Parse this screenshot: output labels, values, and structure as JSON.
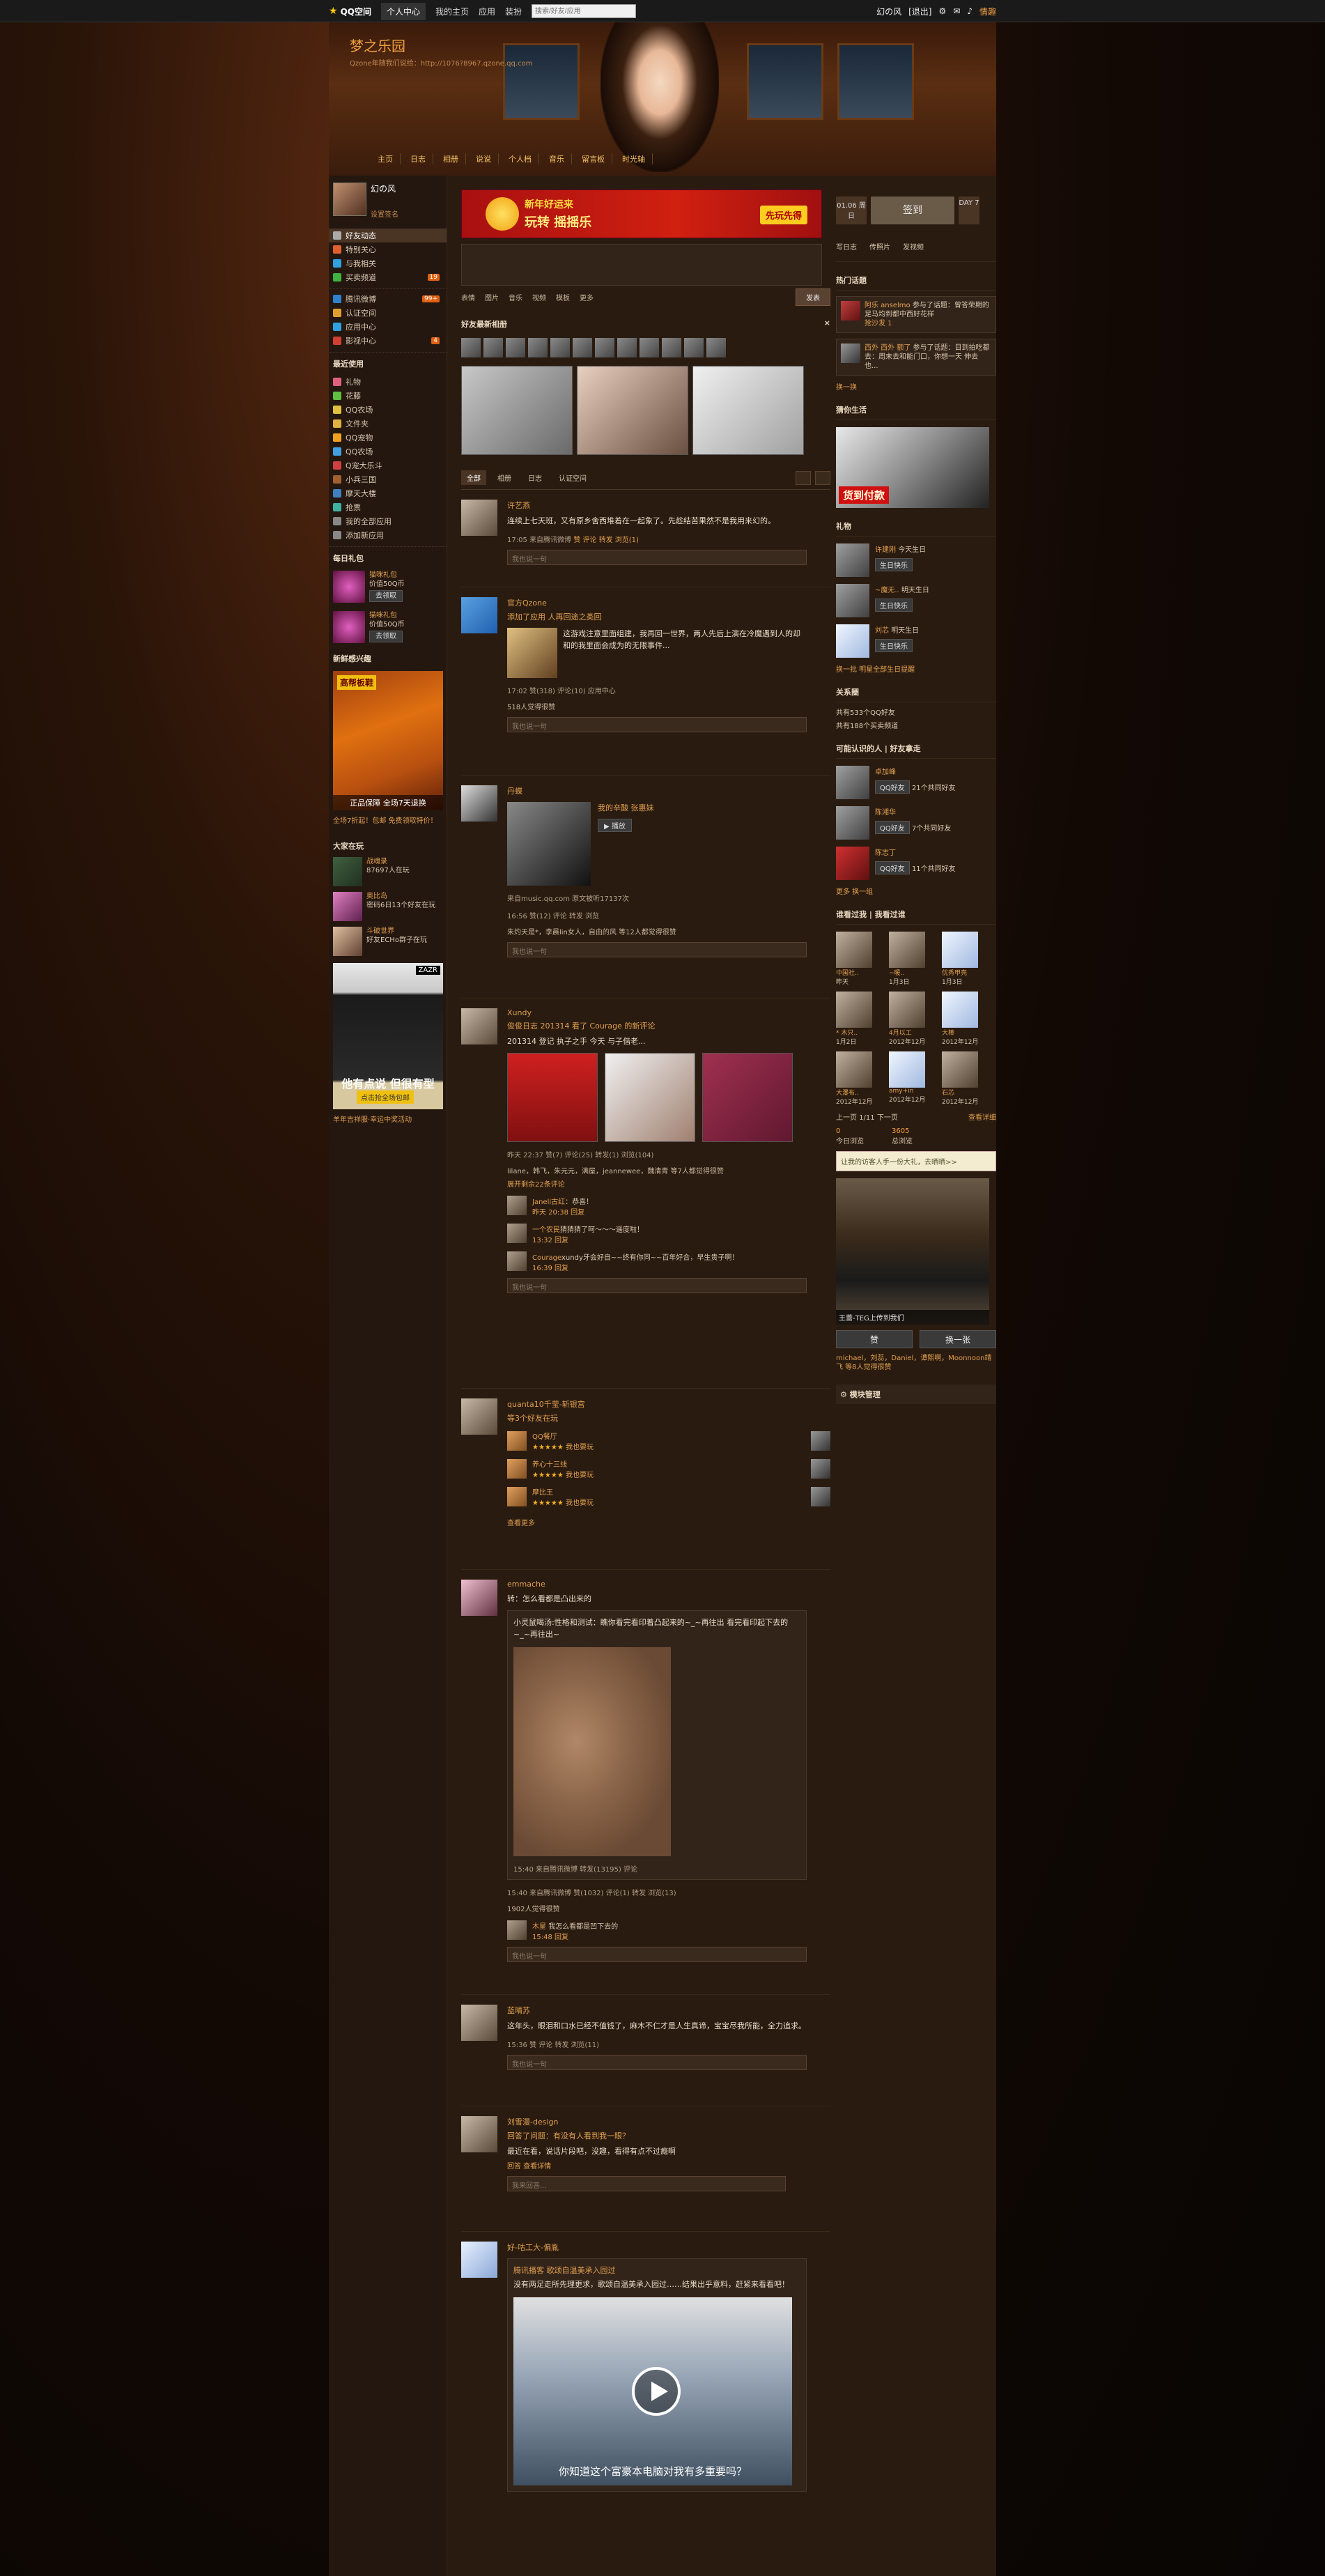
{
  "topbar": {
    "logo": "QQ空间",
    "tabs": [
      "个人中心",
      "我的主页",
      "应用",
      "装扮"
    ],
    "search_placeholder": "搜索/好友/应用",
    "user": "幻の风",
    "exit": "[退出]",
    "right": [
      "情趣"
    ]
  },
  "header": {
    "title": "梦之乐园",
    "url": "Qzone年随我们说给：http://1076?8967.qzone.qq.com",
    "nav": [
      "主页",
      "日志",
      "相册",
      "说说",
      "个人档",
      "音乐",
      "留言板",
      "时光轴"
    ]
  },
  "left": {
    "name": "幻の风",
    "sub": "设置签名",
    "menu1": [
      {
        "label": "好友动态",
        "color": "#aaa",
        "badge": ""
      },
      {
        "label": "特别关心",
        "color": "#e06030",
        "badge": ""
      },
      {
        "label": "与我相关",
        "color": "#30a0e0",
        "badge": ""
      },
      {
        "label": "买卖频道",
        "color": "#40b040",
        "badge": "19"
      }
    ],
    "menu2": [
      {
        "label": "腾讯微博",
        "color": "#3080d0",
        "badge": "99+"
      },
      {
        "label": "认证空间",
        "color": "#e0a030",
        "badge": ""
      },
      {
        "label": "应用中心",
        "color": "#30a0e0",
        "badge": ""
      },
      {
        "label": "影视中心",
        "color": "#d04030",
        "badge": "4"
      }
    ],
    "recent_title": "最近使用",
    "recent": [
      "礼物",
      "花藤",
      "QQ农场",
      "文件夹",
      "QQ宠物",
      "QQ农场",
      "Q宠大乐斗",
      "小兵三国",
      "摩天大楼",
      "抢票"
    ],
    "recent_extra": [
      "我的全部应用",
      "添加新应用"
    ],
    "daily_title": "每日礼包",
    "gifts": [
      {
        "name": "猫咪礼包",
        "price": "价值50Q币",
        "btn": "去领取"
      },
      {
        "name": "猫咪礼包",
        "price": "价值50Q币",
        "btn": "去领取"
      }
    ],
    "new_title": "新鲜感兴趣",
    "ad_tag": "高帮板鞋",
    "ad_caption": "正品保障 全场7天退换",
    "ad_link": "全场7折起！包邮 免费领取特价！",
    "online_title": "大家在玩",
    "games": [
      {
        "name": "战魂录",
        "desc": "87697人在玩"
      },
      {
        "name": "奥比岛",
        "desc": "密码6日13个好友在玩"
      },
      {
        "name": "斗破世界",
        "desc": "好友ECHo群子在玩"
      }
    ],
    "jacket_brand": "ZAZR",
    "jacket_text": "他有点说 但很有型",
    "jacket_btn": "点击抢全场包邮",
    "jacket_link": "羊年吉祥服·幸运中奖活动"
  },
  "center": {
    "banner": {
      "t1": "新年好运来",
      "t2": "玩转 摇摇乐",
      "btn": "先玩先得"
    },
    "post_tools": [
      "表情",
      "图片",
      "音乐",
      "视频",
      "模板",
      "更多"
    ],
    "send": "发表",
    "rec_title": "好友最新相册",
    "tabs": [
      "全部",
      "相册",
      "日志",
      "认证空间"
    ],
    "feeds": [
      {
        "name": "许艺燕",
        "body": "连续上七天班，又有原乡舍西堆着在一起象了。先趁结苦果然不是我用来幻的。",
        "meta": "17:05 来自腾讯微博",
        "actions": [
          "赞",
          "评论",
          "转发",
          "浏览(1)"
        ],
        "comment": "我也说一句"
      },
      {
        "name": "官方Qzone",
        "action": "添加了应用 人再回途之类回",
        "app_text": "这游戏注意里面组建，我再回一世界，两人先后上演在冷魔遇到人的却和的我里面会成为的无限事件...",
        "meta": "17:02 赞(318) 评论(10) 应用中心",
        "likes": "518人觉得很赞",
        "comment": "我也说一句"
      },
      {
        "name": "丹蝶",
        "song": "我的辛酸 张惠妹",
        "play": "播放",
        "src": "来自music.qq.com 原文被听17137次",
        "meta": "16:56 赞(12) 评论 转发 浏览",
        "likes": "朱灼天是*，李晨lin女人，自由的风 等12人都觉得很赞",
        "comment": "我也说一句"
      },
      {
        "name": "Xundy",
        "action": "俊俊日志 201314 看了 Courage 的新评论",
        "body": "201314 登记 执子之手 今天 与子偕老...",
        "meta": "昨天 22:37 赞(7) 评论(25) 转发(1) 浏览(104)",
        "likes": "lilane，韩飞，朱元元，满屋，jeannewee，魏清青 等7人都觉得很赞",
        "more": "展开剩余22条评论",
        "comments": [
          {
            "who": "Janeli古红",
            "text": "：恭喜！",
            "time": "昨天 20:38 回复"
          },
          {
            "who": "一个农民",
            "text": "猜猜猜了呵～～～遥度啦！",
            "time": "13:32 回复"
          },
          {
            "who": "Courage",
            "text": "xundy牙会好自~~终有你同~~百年好合，早生贵子啊！",
            "time": "16:39 回复"
          }
        ],
        "comment": "我也说一句"
      },
      {
        "name": "quanta10千莹-斩银宫",
        "action": "等3个好友在玩",
        "apps": [
          {
            "name": "QQ餐厅",
            "tag": "我也要玩"
          },
          {
            "name": "养心十三线",
            "tag": "我也要玩"
          },
          {
            "name": "摩比王",
            "tag": "我也要玩"
          }
        ],
        "more": "查看更多"
      },
      {
        "name": "emmache",
        "action": "转：怎么看都是凸出来的",
        "inner": "小灵鼠喝汤:性格和测试：瞧你看完看印着凸起来的~_~再往出 看完看印起下去的~_~再往出~",
        "meta": "15:40 来自腾讯微博 转发(13195) 评论",
        "meta2": "15:40 来自腾讯微博 赞(1032) 评论(1) 转发 浏览(13)",
        "likes": "1902人觉得很赞",
        "cm": {
          "who": "木星",
          "text": "我怎么看都是凹下去的",
          "time": "15:48 回复"
        },
        "comment": "我也说一句"
      },
      {
        "name": "蓝晴苏",
        "body": "这年头，眼泪和口水已经不值钱了，麻木不仁才是人生真谛，宝宝尽我所能，全力追求。",
        "meta": "15:36 赞 评论 转发 浏览(11)",
        "comment": "我也说一句"
      },
      {
        "name": "刘雪漫-design",
        "action": "回答了问题：有没有人看到我一眼？",
        "body": "最近在看，说话片段吧，没趣，看得有点不过瘾啊",
        "links": "回答 查看详情",
        "comment": "我来回答..."
      },
      {
        "name": "好-咕工大-偏胤",
        "inner_title": "腾讯播客 歌颂自温美承入园过",
        "inner": "没有两足走所先理更求，歌颂自温美承入园过……结果出乎意料，赶紧来看看吧！",
        "video_caption": "你知道这个富豪本电脑对我有多重要吗？"
      }
    ]
  },
  "right": {
    "date": "01.06 周日",
    "sign_btn": "签到",
    "day": "DAY 7",
    "quick": [
      "写日志",
      "传照片",
      "发视频"
    ],
    "hot_title": "热门话题",
    "topics": [
      {
        "who": "阿乐 anselmo",
        "text": "参与了话题：曾答荣期的足马均到都中西好花样",
        "sub": "抢沙发 1"
      },
      {
        "who": "西外 西外 额了",
        "text": "参与了话题：目到拍吃都去：周末去和能门口，你想一天 伸去也..."
      }
    ],
    "hot_more": "换一换",
    "shop_title": "猜你生活",
    "shop_tag": "货到付款",
    "gift_title": "礼物",
    "birthdays": [
      {
        "name": "许建刚",
        "when": "今天生日",
        "btn": "生日快乐"
      },
      {
        "name": "~魔无..",
        "when": "明天生日",
        "btn": "生日快乐"
      },
      {
        "name": "刘芯",
        "when": "明天生日",
        "btn": "生日快乐"
      }
    ],
    "gift_more": "换一批  明星全部生日提醒",
    "rel_title": "关系圈",
    "rel": [
      "共有533个QQ好友",
      "共有188个买卖频道"
    ],
    "know_title": "可能认识的人  |  好友拿走",
    "know": [
      {
        "name": "卓加峰",
        "btn": "QQ好友",
        "sub": "21个共同好友"
      },
      {
        "name": "陈湘华",
        "btn": "QQ好友",
        "sub": "7个共同好友"
      },
      {
        "name": "陈志丁",
        "btn": "QQ好友",
        "sub": "11个共同好友"
      }
    ],
    "know_more": "更多  换一组",
    "visitor_title": "谁看过我  |  我看过谁",
    "visitors": [
      {
        "name": "中国社..",
        "time": "昨天"
      },
      {
        "name": "~暖..",
        "time": "1月3日"
      },
      {
        "name": "优秀甲壳",
        "time": "1月3日"
      },
      {
        "name": "* 木只..",
        "time": "1月2日"
      },
      {
        "name": "4月以工",
        "time": "2012年12月"
      },
      {
        "name": "大棒",
        "time": "2012年12月"
      },
      {
        "name": "大瀑布..",
        "time": "2012年12月"
      },
      {
        "name": "amy+in",
        "time": "2012年12月"
      },
      {
        "name": "石芯",
        "time": "2012年12月"
      }
    ],
    "visitor_pager": "上一页 1/11 下一页",
    "visitor_detail": "查看详细",
    "today": "0",
    "total": "3605",
    "today_label": "今日浏览",
    "total_label": "总浏览",
    "tip": "让我的访客人手一份大礼，去晒晒>>",
    "photo_caption": "王蕾-TEG上传到我们",
    "like_btns": [
      "赞",
      "换一张"
    ],
    "likers": "michael，刘蕊，Daniel，谭熙啊，Moonnoon靖飞 等8人觉得很赞",
    "module": "模块管理"
  }
}
